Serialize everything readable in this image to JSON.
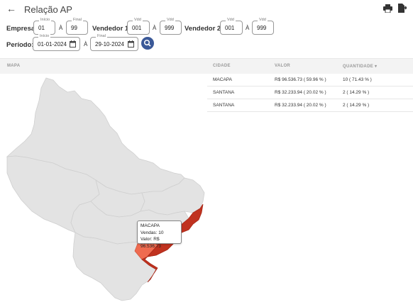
{
  "header": {
    "title": "Relação AP"
  },
  "filters": {
    "empresa": {
      "label": "Empresa:",
      "inicio_caption": "Início",
      "inicio_value": "01",
      "final_caption": "Final",
      "final_value": "99"
    },
    "vendedor1": {
      "label": "Vendedor 1:",
      "from_caption": "Vdd",
      "from_value": "001",
      "to_caption": "Vdd",
      "to_value": "999"
    },
    "vendedor2": {
      "label": "Vendedor 2:",
      "from_caption": "Vdd",
      "from_value": "001",
      "to_caption": "Vdd",
      "to_value": "999"
    },
    "periodo": {
      "label": "Período:",
      "inicio_caption": "Início",
      "inicio_value": "01-01-2024",
      "final_caption": "Final",
      "final_value": "29-10-2024"
    },
    "separator": "À"
  },
  "columns": {
    "mapa": "MAPA",
    "cidade": "CIDADE",
    "valor": "VALOR",
    "quantidade": "QUANTIDADE ▾"
  },
  "rows": [
    {
      "cidade": "MACAPA",
      "valor": "R$ 96.536.73 ( 59.96 % )",
      "quantidade": "10 ( 71.43 % )"
    },
    {
      "cidade": "SANTANA",
      "valor": "R$ 32.233.94 ( 20.02 % )",
      "quantidade": "2 ( 14.29 % )"
    },
    {
      "cidade": "SANTANA",
      "valor": "R$ 32.233.94 ( 20.02 % )",
      "quantidade": "2 ( 14.29 % )"
    }
  ],
  "tooltip": {
    "city": "MACAPA",
    "vendas": "Vendas: 10",
    "valor": "Valor: R$ 96.536.73"
  },
  "colors": {
    "accent": "#3b5998",
    "map_fill": "#e3e3e3",
    "map_border": "#cfcfcf",
    "highlight_dark": "#c0321f",
    "highlight_mid": "#e24a33",
    "highlight_light": "#ef6b50"
  }
}
